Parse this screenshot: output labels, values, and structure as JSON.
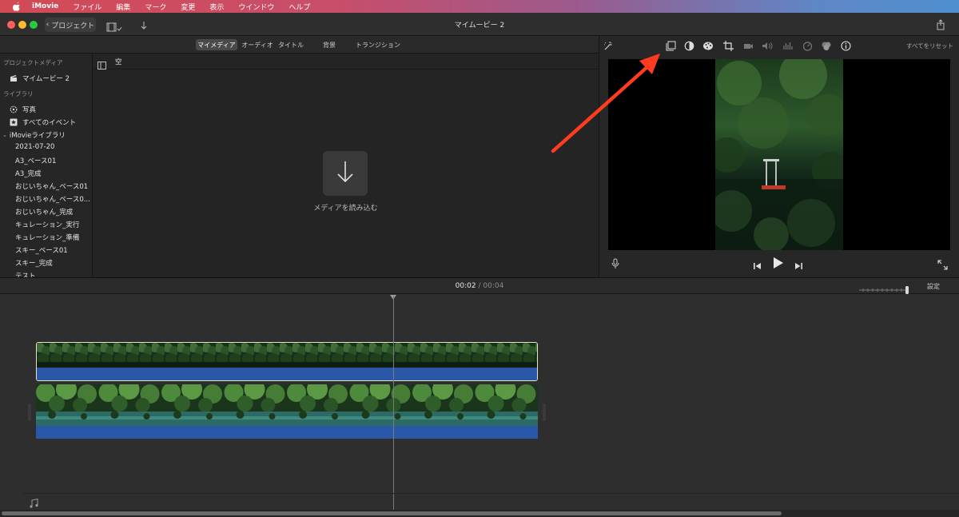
{
  "menubar": {
    "app_name": "iMovie",
    "items": [
      "ファイル",
      "編集",
      "マーク",
      "変更",
      "表示",
      "ウインドウ",
      "ヘルプ"
    ]
  },
  "window": {
    "title": "マイムービー 2",
    "back_label": "プロジェクト"
  },
  "browser": {
    "tabs": [
      "マイメディア",
      "オーディオ",
      "タイトル",
      "背景",
      "トランジション"
    ],
    "active_tab": "マイメディア",
    "filter_label": "空",
    "import_label": "メディアを読み込む"
  },
  "sidebar": {
    "project_media_header": "プロジェクトメディア",
    "project_item": "マイムービー 2",
    "library_header": "ライブラリ",
    "library_items": [
      "写真",
      "すべてのイベント"
    ],
    "library_name": "iMovieライブラリ",
    "events": [
      "2021-07-20",
      "A3_ベース01",
      "A3_完成",
      "おじいちゃん_ベース01",
      "おじいちゃん_ベース0...",
      "おじいちゃん_完成",
      "キュレーション_実行",
      "キュレーション_準備",
      "スキー_ベース01",
      "スキー_完成",
      "テスト"
    ]
  },
  "viewer": {
    "reset_all_label": "すべてをリセット",
    "tool_icons": [
      "magic-wand-icon",
      "crop-to-fill-icon",
      "color-balance-icon",
      "color-correction-icon",
      "crop-icon",
      "stabilization-icon",
      "volume-icon",
      "noise-reduction-icon",
      "speed-icon",
      "clip-filter-icon",
      "info-icon"
    ]
  },
  "timeline": {
    "current_time": "00:02",
    "separator": "/",
    "duration": "00:04",
    "settings_label": "設定"
  },
  "colors": {
    "accent_red": "#ff3b20",
    "audio_blue": "#2a57a8",
    "selection_border": "#e8e4c8"
  }
}
